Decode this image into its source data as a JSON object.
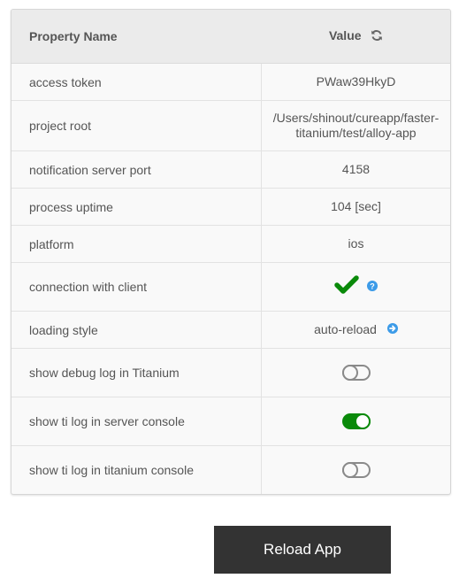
{
  "table": {
    "headers": {
      "name": "Property Name",
      "value": "Value"
    },
    "header_icon": "refresh-icon",
    "rows": [
      {
        "name": "access token",
        "value": "PWaw39HkyD"
      },
      {
        "name": "project root",
        "value": "/Users/shinout/cureapp/faster-titanium/test/alloy-app"
      },
      {
        "name": "notification server port",
        "value": "4158"
      },
      {
        "name": "process uptime",
        "value": "104 [sec]"
      },
      {
        "name": "platform",
        "value": "ios"
      },
      {
        "name": "connection with client",
        "value": "",
        "status": "connected",
        "icons": [
          "check-icon",
          "question-circle-icon"
        ]
      },
      {
        "name": "loading style",
        "value": "auto-reload",
        "icons": [
          "arrow-circle-right-icon"
        ]
      },
      {
        "name": "show debug log in Titanium",
        "toggle": false
      },
      {
        "name": "show ti log in server console",
        "toggle": true
      },
      {
        "name": "show ti log in titanium console",
        "toggle": false
      }
    ]
  },
  "colors": {
    "accent_green": "#0a8a0a",
    "info_blue": "#3c9be8",
    "button_bg": "#333333"
  },
  "button": {
    "reload_label": "Reload App"
  }
}
